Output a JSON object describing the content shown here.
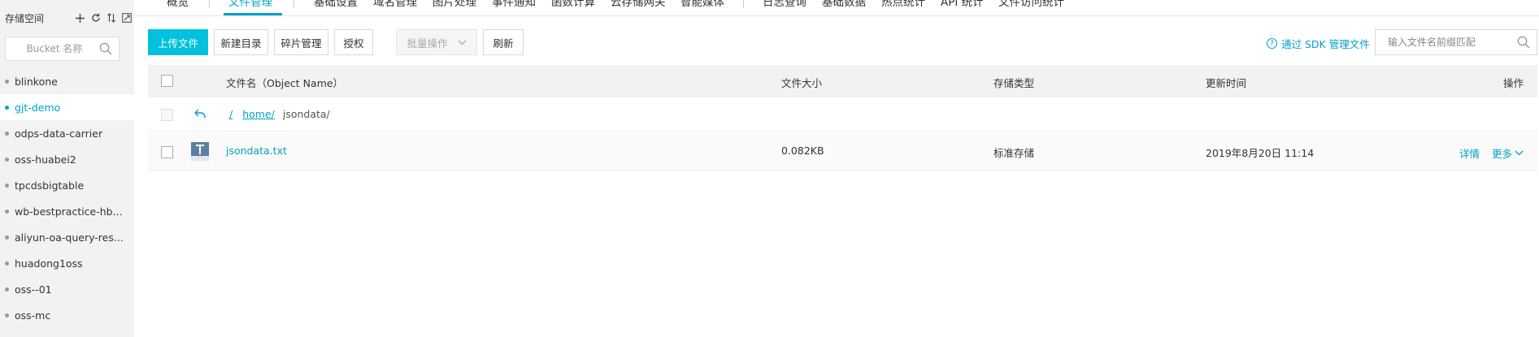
{
  "sidebar": {
    "title": "存储空间",
    "search_placeholder": "Bucket 名称",
    "buckets": [
      {
        "label": "blinkone",
        "active": false
      },
      {
        "label": "gjt-demo",
        "active": true
      },
      {
        "label": "odps-data-carrier",
        "active": false
      },
      {
        "label": "oss-huabei2",
        "active": false
      },
      {
        "label": "tpcdsbigtable",
        "active": false
      },
      {
        "label": "wb-bestpractice-hb...",
        "active": false
      },
      {
        "label": "aliyun-oa-query-res...",
        "active": false
      },
      {
        "label": "huadong1oss",
        "active": false
      },
      {
        "label": "oss--01",
        "active": false
      },
      {
        "label": "oss-mc",
        "active": false
      }
    ]
  },
  "tabs": [
    "概览",
    "文件管理",
    "基础设置",
    "域名管理",
    "图片处理",
    "事件通知",
    "函数计算",
    "云存储网关",
    "智能媒体",
    "日志查询",
    "基础数据",
    "热点统计",
    "API 统计",
    "文件访问统计"
  ],
  "active_tab": "文件管理",
  "toolbar": {
    "upload": "上传文件",
    "new_dir": "新建目录",
    "fragments": "碎片管理",
    "authorize": "授权",
    "batch": "批量操作",
    "refresh": "刷新",
    "sdk_link": "通过 SDK 管理文件",
    "file_search_placeholder": "输入文件名前缀匹配"
  },
  "table": {
    "headers": {
      "name": "文件名（Object Name）",
      "size": "文件大小",
      "storage": "存储类型",
      "updated": "更新时间",
      "actions": "操作"
    },
    "breadcrumb": {
      "root": "/",
      "parent": "home/",
      "current": "jsondata/"
    },
    "rows": [
      {
        "name": "jsondata.txt",
        "size": "0.082KB",
        "storage": "标准存储",
        "updated": "2019年8月20日 11:14",
        "detail": "详情",
        "more": "更多"
      }
    ]
  },
  "colors": {
    "accent": "#00a2ca",
    "primary_button": "#00c1de",
    "sidebar_bg": "#f2f2f2",
    "header_bg": "#f2f2f2"
  }
}
